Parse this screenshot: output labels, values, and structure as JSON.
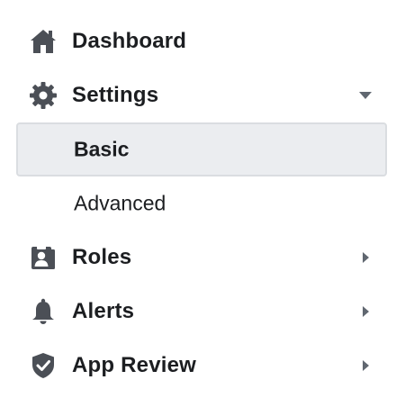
{
  "nav": {
    "dashboard": {
      "label": "Dashboard",
      "icon": "house-icon"
    },
    "settings": {
      "label": "Settings",
      "icon": "gear-icon",
      "expanded": true,
      "caret": "caret-down-icon",
      "children": {
        "basic": {
          "label": "Basic",
          "active": true
        },
        "advanced": {
          "label": "Advanced",
          "active": false
        }
      }
    },
    "roles": {
      "label": "Roles",
      "icon": "roles-badge-icon",
      "caret": "caret-right-icon"
    },
    "alerts": {
      "label": "Alerts",
      "icon": "bell-icon",
      "caret": "caret-right-icon"
    },
    "app_review": {
      "label": "App Review",
      "icon": "shield-check-icon",
      "caret": "caret-right-icon"
    }
  },
  "colors": {
    "icon": "#4b4f56",
    "text": "#1c1e21",
    "active_bg": "#ebedf0",
    "active_border": "#dadde1",
    "caret": "#606770"
  }
}
